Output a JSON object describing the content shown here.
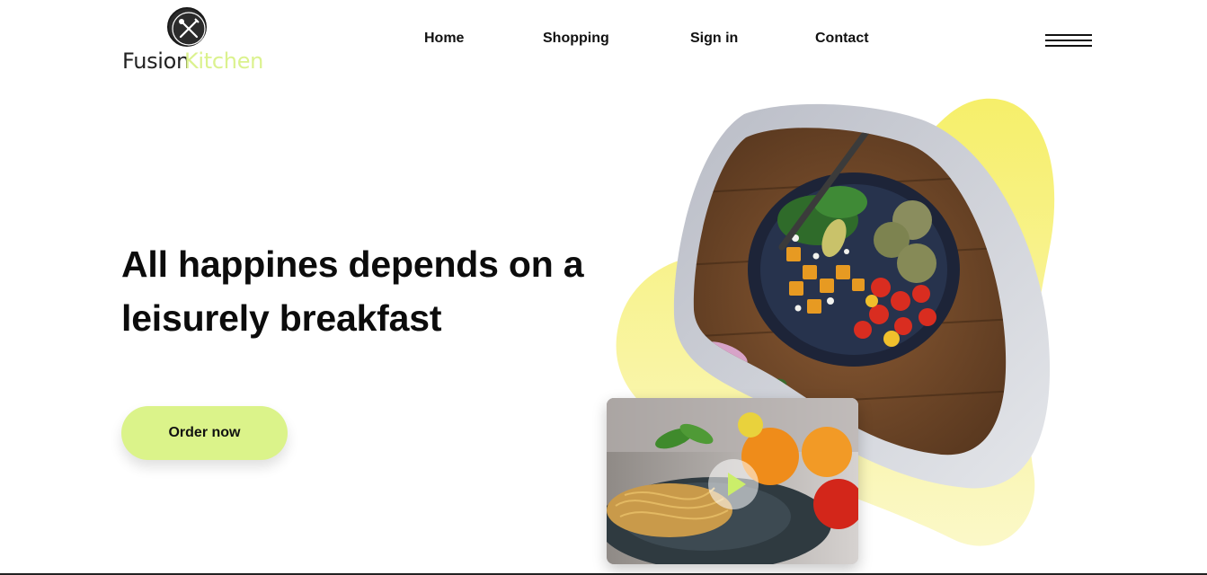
{
  "brand": {
    "name_part1": "Fusion",
    "name_part2": "Kitchen",
    "logo_icon": "fork-knife-icon",
    "accent_color": "#dbf28e"
  },
  "nav": {
    "items": [
      {
        "label": "Home"
      },
      {
        "label": "Shopping"
      },
      {
        "label": "Sign in"
      },
      {
        "label": "Contact"
      }
    ],
    "menu_icon": "hamburger-menu-icon"
  },
  "hero": {
    "headline_line1": "All happines depends on a",
    "headline_line2": "leisurely breakfast",
    "cta_label": "Order now",
    "cta_color": "#dbf38a"
  },
  "media": {
    "main_image": "salad-bowl-photo",
    "video_thumbnail": "pasta-dish-photo",
    "play_icon": "play-icon",
    "blob_color": "#f7f27a",
    "frame_color": "#c4c7cf"
  }
}
